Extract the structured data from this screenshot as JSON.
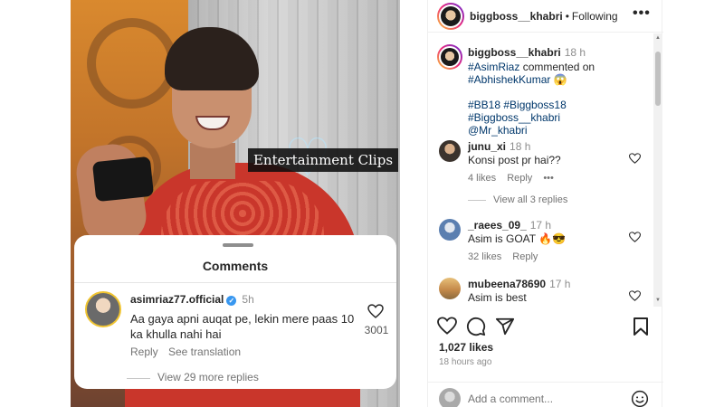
{
  "media": {
    "overlay_label": "Entertainment Clips",
    "comments_card": {
      "title": "Comments",
      "username": "asimriaz77.official",
      "verified_glyph": "✓",
      "time": "5h",
      "text": "Aa gaya apni auqat pe, lekin mere paas 10 ka khulla nahi hai",
      "like_count": "3001",
      "reply": "Reply",
      "see_translation": "See translation",
      "view_more": "View 29 more replies"
    }
  },
  "post": {
    "header": {
      "username": "biggboss__khabri",
      "separator": "•",
      "follow_status": "Following",
      "more_glyph": "•••"
    },
    "caption": {
      "username": "biggboss__khabri",
      "time": "18 h",
      "line1_tag": "#AsimRiaz",
      "line1_text": " commented on",
      "line2_tag": "#AbhishekKumar",
      "line2_emoji": " 😱",
      "tags_line1": "#BB18 #Biggboss18 #Biggboss__khabri",
      "tags_line2": "@Mr_khabri"
    },
    "comments": [
      {
        "username": "junu_xi",
        "time": "18 h",
        "text": "Konsi post pr hai??",
        "likes": "4 likes",
        "reply": "Reply",
        "more": "•••",
        "view_replies": "View all 3 replies"
      },
      {
        "username": "_raees_09_",
        "time": "17 h",
        "text": "Asim is GOAT 🔥😎",
        "likes": "32 likes",
        "reply": "Reply"
      },
      {
        "username": "mubeena78690",
        "time": "17 h",
        "text": "Asim is best"
      }
    ],
    "likes_count": "1,027 likes",
    "posted_ago": "18 hours ago",
    "add_comment_placeholder": "Add a comment...",
    "icons": [
      "heart-icon",
      "comment-icon",
      "share-icon",
      "bookmark-icon",
      "emoji-icon"
    ]
  }
}
